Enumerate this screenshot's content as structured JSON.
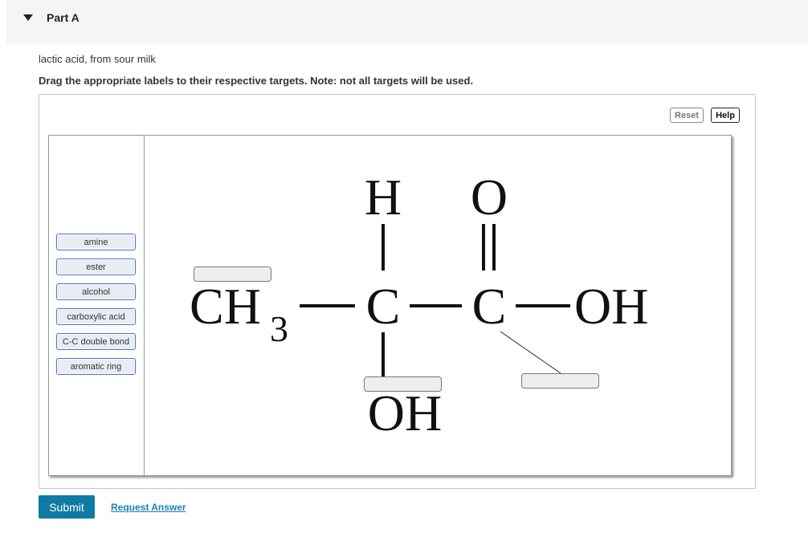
{
  "part": {
    "title": "Part A",
    "toggle_icon": "caret-down-icon"
  },
  "prompt": "lactic acid, from sour milk",
  "instructions": "Drag the appropriate labels to their respective targets. Note: not all targets will be used.",
  "controls": {
    "reset_label": "Reset",
    "help_label": "Help"
  },
  "labels": [
    "amine",
    "ester",
    "alcohol",
    "carboxylic acid",
    "C-C double bond",
    "aromatic ring"
  ],
  "molecule": {
    "atoms": {
      "h_top": "H",
      "o_top": "O",
      "ch": "CH",
      "sub3": "3",
      "c1": "C",
      "c2": "C",
      "oh_right": "OH",
      "oh_bottom": "OH"
    }
  },
  "footer": {
    "submit_label": "Submit",
    "request_answer_label": "Request Answer"
  }
}
